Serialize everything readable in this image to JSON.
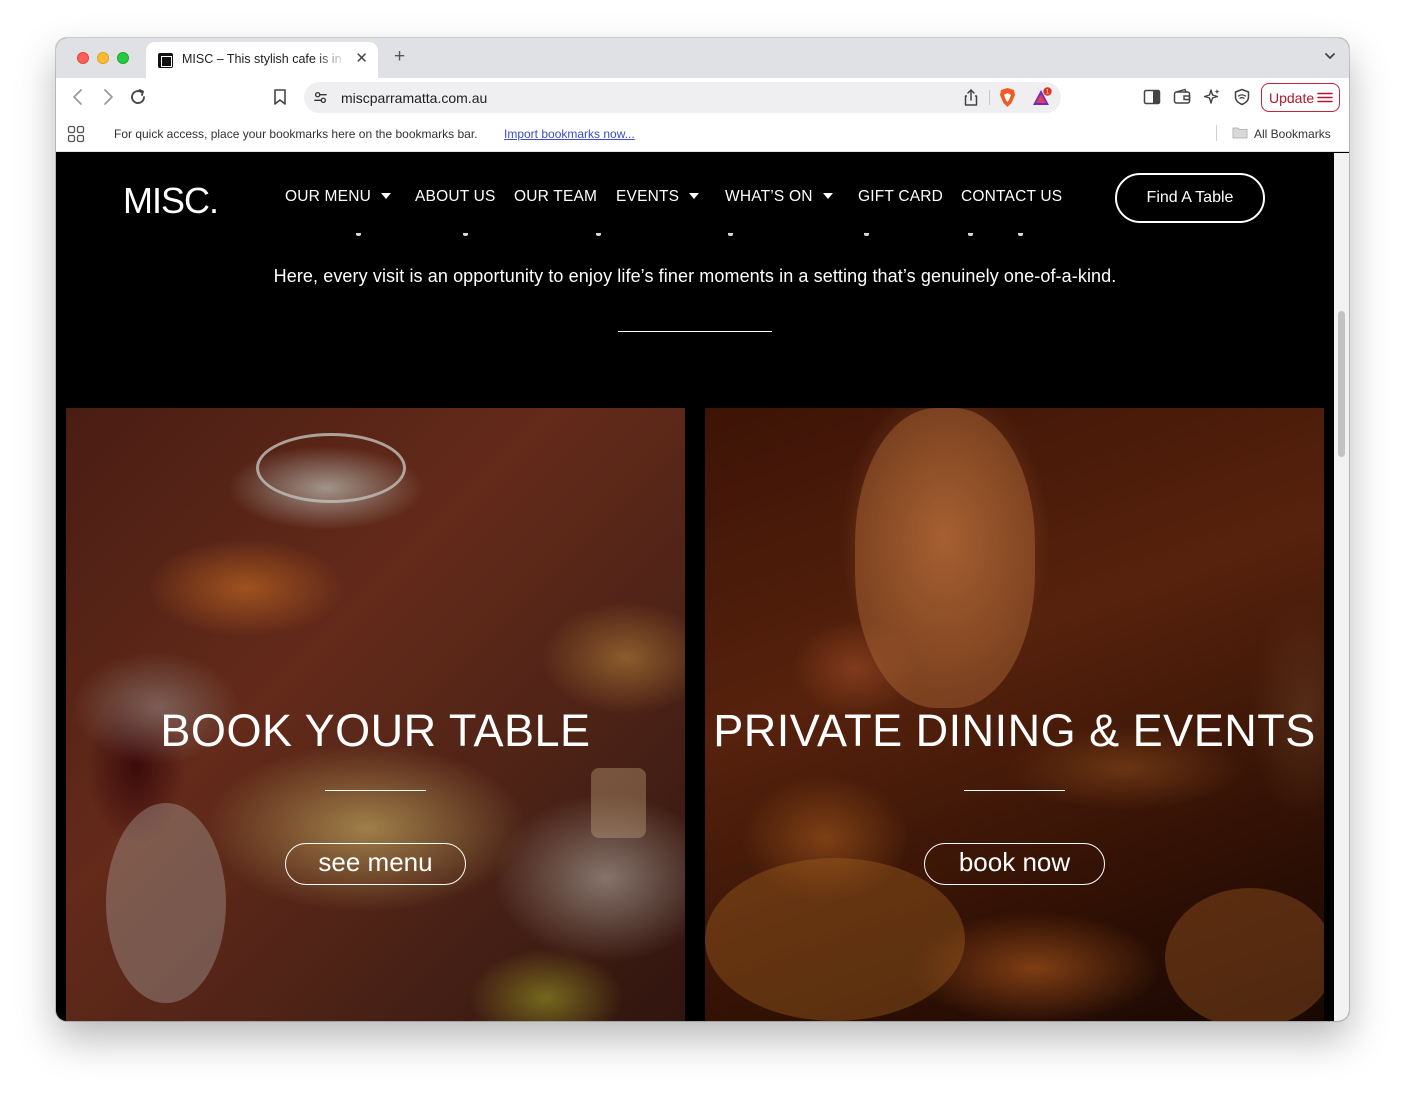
{
  "browser": {
    "tab": {
      "title": "MISC – This stylish cafe is in",
      "close_glyph": "✕"
    },
    "new_tab_glyph": "+",
    "address": {
      "url": "miscparramatta.com.au"
    },
    "update_label": "Update",
    "bookmarks_bar": {
      "message": "For quick access, place your bookmarks here on the bookmarks bar.",
      "import_link": "Import bookmarks now...",
      "all_bookmarks": "All Bookmarks"
    },
    "badge_count": "1"
  },
  "site": {
    "logo": "MISC.",
    "nav": {
      "our_menu": "OUR MENU",
      "about_us": "ABOUT US",
      "our_team": "OUR TEAM",
      "events": "EVENTS",
      "whats_on": "WHAT’S ON",
      "gift_card": "GIFT CARD",
      "contact_us": "CONTACT US"
    },
    "find_table": "Find A Table",
    "intro": "Here, every visit is an opportunity to enjoy life’s finer moments in a setting that’s genuinely one-of-a-kind.",
    "panels": {
      "left": {
        "title": "BOOK YOUR TABLE",
        "button": "see menu"
      },
      "right": {
        "title": "PRIVATE DINING & EVENTS",
        "button": "book now"
      }
    }
  },
  "colors": {
    "page_bg": "#000000",
    "text": "#ffffff",
    "update_accent": "#c0233a",
    "link": "#3b4cc8"
  },
  "icons": [
    "back-arrow-icon",
    "forward-arrow-icon",
    "reload-icon",
    "bookmark-icon",
    "site-settings-icon",
    "share-icon",
    "brave-shield-icon",
    "brave-rewards-icon",
    "sidebar-icon",
    "wallet-icon",
    "leo-ai-icon",
    "vpn-shield-icon",
    "menu-icon",
    "apps-grid-icon",
    "folder-icon",
    "tab-search-chevron-icon"
  ]
}
